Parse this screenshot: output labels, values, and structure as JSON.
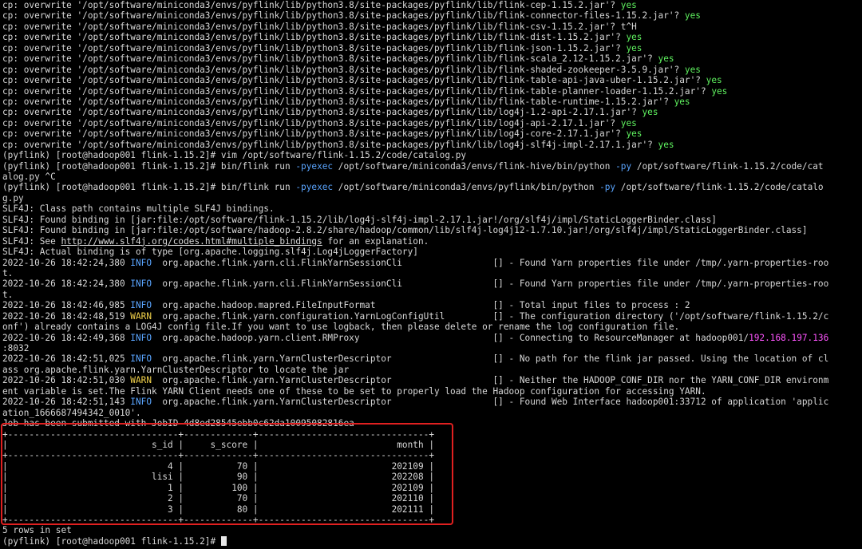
{
  "terminal": {
    "lines": [
      {
        "segments": [
          {
            "t": "cp: overwrite '/opt/software/miniconda3/envs/pyflink/lib/python3.8/site-packages/pyflink/lib/flink-cep-1.15.2.jar'? ",
            "s": ""
          },
          {
            "t": "yes",
            "s": "yes"
          }
        ]
      },
      {
        "segments": [
          {
            "t": "cp: overwrite '/opt/software/miniconda3/envs/pyflink/lib/python3.8/site-packages/pyflink/lib/flink-connector-files-1.15.2.jar'? ",
            "s": ""
          },
          {
            "t": "yes",
            "s": "yes"
          }
        ]
      },
      {
        "segments": [
          {
            "t": "cp: overwrite '/opt/software/miniconda3/envs/pyflink/lib/python3.8/site-packages/pyflink/lib/flink-csv-1.15.2.jar'? t^H",
            "s": ""
          }
        ]
      },
      {
        "segments": [
          {
            "t": "cp: overwrite '/opt/software/miniconda3/envs/pyflink/lib/python3.8/site-packages/pyflink/lib/flink-dist-1.15.2.jar'? ",
            "s": ""
          },
          {
            "t": "yes",
            "s": "yes"
          }
        ]
      },
      {
        "segments": [
          {
            "t": "cp: overwrite '/opt/software/miniconda3/envs/pyflink/lib/python3.8/site-packages/pyflink/lib/flink-json-1.15.2.jar'? ",
            "s": ""
          },
          {
            "t": "yes",
            "s": "yes"
          }
        ]
      },
      {
        "segments": [
          {
            "t": "cp: overwrite '/opt/software/miniconda3/envs/pyflink/lib/python3.8/site-packages/pyflink/lib/flink-scala_2.12-1.15.2.jar'? ",
            "s": ""
          },
          {
            "t": "yes",
            "s": "yes"
          }
        ]
      },
      {
        "segments": [
          {
            "t": "cp: overwrite '/opt/software/miniconda3/envs/pyflink/lib/python3.8/site-packages/pyflink/lib/flink-shaded-zookeeper-3.5.9.jar'? ",
            "s": ""
          },
          {
            "t": "yes",
            "s": "yes"
          }
        ]
      },
      {
        "segments": [
          {
            "t": "cp: overwrite '/opt/software/miniconda3/envs/pyflink/lib/python3.8/site-packages/pyflink/lib/flink-table-api-java-uber-1.15.2.jar'? ",
            "s": ""
          },
          {
            "t": "yes",
            "s": "yes"
          }
        ]
      },
      {
        "segments": [
          {
            "t": "cp: overwrite '/opt/software/miniconda3/envs/pyflink/lib/python3.8/site-packages/pyflink/lib/flink-table-planner-loader-1.15.2.jar'? ",
            "s": ""
          },
          {
            "t": "yes",
            "s": "yes"
          }
        ]
      },
      {
        "segments": [
          {
            "t": "cp: overwrite '/opt/software/miniconda3/envs/pyflink/lib/python3.8/site-packages/pyflink/lib/flink-table-runtime-1.15.2.jar'? ",
            "s": ""
          },
          {
            "t": "yes",
            "s": "yes"
          }
        ]
      },
      {
        "segments": [
          {
            "t": "cp: overwrite '/opt/software/miniconda3/envs/pyflink/lib/python3.8/site-packages/pyflink/lib/log4j-1.2-api-2.17.1.jar'? ",
            "s": ""
          },
          {
            "t": "yes",
            "s": "yes"
          }
        ]
      },
      {
        "segments": [
          {
            "t": "cp: overwrite '/opt/software/miniconda3/envs/pyflink/lib/python3.8/site-packages/pyflink/lib/log4j-api-2.17.1.jar'? ",
            "s": ""
          },
          {
            "t": "yes",
            "s": "yes"
          }
        ]
      },
      {
        "segments": [
          {
            "t": "cp: overwrite '/opt/software/miniconda3/envs/pyflink/lib/python3.8/site-packages/pyflink/lib/log4j-core-2.17.1.jar'? ",
            "s": ""
          },
          {
            "t": "yes",
            "s": "yes"
          }
        ]
      },
      {
        "segments": [
          {
            "t": "cp: overwrite '/opt/software/miniconda3/envs/pyflink/lib/python3.8/site-packages/pyflink/lib/log4j-slf4j-impl-2.17.1.jar'? ",
            "s": ""
          },
          {
            "t": "yes",
            "s": "yes"
          }
        ]
      },
      {
        "segments": [
          {
            "t": "(pyflink) [root@hadoop001 flink-1.15.2]# vim /opt/software/flink-1.15.2/code/catalog.py",
            "s": ""
          }
        ]
      },
      {
        "segments": [
          {
            "t": "(pyflink) [root@hadoop001 flink-1.15.2]# bin/flink run ",
            "s": ""
          },
          {
            "t": "-pyexec",
            "s": "flag"
          },
          {
            "t": " /opt/software/miniconda3/envs/flink-hive/bin/python ",
            "s": ""
          },
          {
            "t": "-py",
            "s": "flag"
          },
          {
            "t": " /opt/software/flink-1.15.2/code/cat",
            "s": ""
          }
        ]
      },
      {
        "segments": [
          {
            "t": "alog.py ^C",
            "s": ""
          }
        ]
      },
      {
        "segments": [
          {
            "t": "(pyflink) [root@hadoop001 flink-1.15.2]# bin/flink run ",
            "s": ""
          },
          {
            "t": "-pyexec",
            "s": "flag"
          },
          {
            "t": " /opt/software/miniconda3/envs/pyflink/bin/python ",
            "s": ""
          },
          {
            "t": "-py",
            "s": "flag"
          },
          {
            "t": " /opt/software/flink-1.15.2/code/catalo",
            "s": ""
          }
        ]
      },
      {
        "segments": [
          {
            "t": "g.py",
            "s": ""
          }
        ]
      },
      {
        "segments": [
          {
            "t": "SLF4J: Class path contains multiple SLF4J bindings.",
            "s": ""
          }
        ]
      },
      {
        "segments": [
          {
            "t": "SLF4J: Found binding in [jar:file:/opt/software/flink-1.15.2/lib/log4j-slf4j-impl-2.17.1.jar!/org/slf4j/impl/StaticLoggerBinder.class]",
            "s": ""
          }
        ]
      },
      {
        "segments": [
          {
            "t": "SLF4J: Found binding in [jar:file:/opt/software/hadoop-2.8.2/share/hadoop/common/lib/slf4j-log4j12-1.7.10.jar!/org/slf4j/impl/StaticLoggerBinder.class]",
            "s": ""
          }
        ]
      },
      {
        "segments": [
          {
            "t": "SLF4J: See ",
            "s": ""
          },
          {
            "t": "http://www.slf4j.org/codes.html#multiple_bindings",
            "s": "link"
          },
          {
            "t": " for an explanation.",
            "s": ""
          }
        ]
      },
      {
        "segments": [
          {
            "t": "SLF4J: Actual binding is of type [org.apache.logging.slf4j.Log4jLoggerFactory]",
            "s": ""
          }
        ]
      },
      {
        "segments": [
          {
            "t": "2022-10-26 18:42:24,380 ",
            "s": ""
          },
          {
            "t": "INFO",
            "s": "info"
          },
          {
            "t": "  org.apache.flink.yarn.cli.FlinkYarnSessionCli                 [] - Found Yarn properties file under /tmp/.yarn-properties-roo",
            "s": ""
          }
        ]
      },
      {
        "segments": [
          {
            "t": "t.",
            "s": ""
          }
        ]
      },
      {
        "segments": [
          {
            "t": "2022-10-26 18:42:24,380 ",
            "s": ""
          },
          {
            "t": "INFO",
            "s": "info"
          },
          {
            "t": "  org.apache.flink.yarn.cli.FlinkYarnSessionCli                 [] - Found Yarn properties file under /tmp/.yarn-properties-roo",
            "s": ""
          }
        ]
      },
      {
        "segments": [
          {
            "t": "t.",
            "s": ""
          }
        ]
      },
      {
        "segments": [
          {
            "t": "2022-10-26 18:42:46,985 ",
            "s": ""
          },
          {
            "t": "INFO",
            "s": "info"
          },
          {
            "t": "  org.apache.hadoop.mapred.FileInputFormat                      [] - Total input files to process : 2",
            "s": ""
          }
        ]
      },
      {
        "segments": [
          {
            "t": "2022-10-26 18:42:48,519 ",
            "s": ""
          },
          {
            "t": "WARN",
            "s": "warn"
          },
          {
            "t": "  org.apache.flink.yarn.configuration.YarnLogConfigUtil         [] - The configuration directory ('/opt/software/flink-1.15.2/c",
            "s": ""
          }
        ]
      },
      {
        "segments": [
          {
            "t": "onf') already contains a LOG4J config file.If you want to use logback, then please delete or rename the log configuration file.",
            "s": ""
          }
        ]
      },
      {
        "segments": [
          {
            "t": "2022-10-26 18:42:49,368 ",
            "s": ""
          },
          {
            "t": "INFO",
            "s": "info"
          },
          {
            "t": "  org.apache.hadoop.yarn.client.RMProxy                         [] - Connecting to ResourceManager at hadoop001/",
            "s": ""
          },
          {
            "t": "192.168.197.136",
            "s": "ip"
          }
        ]
      },
      {
        "segments": [
          {
            "t": ":8032",
            "s": ""
          }
        ]
      },
      {
        "segments": [
          {
            "t": "2022-10-26 18:42:51,025 ",
            "s": ""
          },
          {
            "t": "INFO",
            "s": "info"
          },
          {
            "t": "  org.apache.flink.yarn.YarnClusterDescriptor                   [] - No path for the flink jar passed. Using the location of cl",
            "s": ""
          }
        ]
      },
      {
        "segments": [
          {
            "t": "ass org.apache.flink.yarn.YarnClusterDescriptor to locate the jar",
            "s": ""
          }
        ]
      },
      {
        "segments": [
          {
            "t": "2022-10-26 18:42:51,030 ",
            "s": ""
          },
          {
            "t": "WARN",
            "s": "warn"
          },
          {
            "t": "  org.apache.flink.yarn.YarnClusterDescriptor                   [] - Neither the HADOOP_CONF_DIR nor the YARN_CONF_DIR environm",
            "s": ""
          }
        ]
      },
      {
        "segments": [
          {
            "t": "ent variable is set.The Flink YARN Client needs one of these to be set to properly load the Hadoop configuration for accessing YARN.",
            "s": ""
          }
        ]
      },
      {
        "segments": [
          {
            "t": "2022-10-26 18:42:51,143 ",
            "s": ""
          },
          {
            "t": "INFO",
            "s": "info"
          },
          {
            "t": "  org.apache.flink.yarn.YarnClusterDescriptor                   [] - Found Web Interface hadoop001:33712 of application 'applic",
            "s": ""
          }
        ]
      },
      {
        "segments": [
          {
            "t": "ation_1666687494342_0010'.",
            "s": ""
          }
        ]
      },
      {
        "segments": [
          {
            "t": "Job has been submitted with JobID 4d8ed28545ebb0c62da10095082816ea",
            "s": ""
          }
        ]
      },
      {
        "segments": [
          {
            "t": "+--------------------------------+-------------+--------------------------------+",
            "s": ""
          }
        ]
      },
      {
        "segments": [
          {
            "t": "|                           s_id |     s_score |                          month |",
            "s": ""
          }
        ]
      },
      {
        "segments": [
          {
            "t": "+--------------------------------+-------------+--------------------------------+",
            "s": ""
          }
        ]
      },
      {
        "segments": [
          {
            "t": "|                              4 |          70 |                         202109 |",
            "s": ""
          }
        ]
      },
      {
        "segments": [
          {
            "t": "|                           lisi |          90 |                         202208 |",
            "s": ""
          }
        ]
      },
      {
        "segments": [
          {
            "t": "|                              1 |         100 |                         202109 |",
            "s": ""
          }
        ]
      },
      {
        "segments": [
          {
            "t": "|                              2 |          70 |                         202110 |",
            "s": ""
          }
        ]
      },
      {
        "segments": [
          {
            "t": "|                              3 |          80 |                         202111 |",
            "s": ""
          }
        ]
      },
      {
        "segments": [
          {
            "t": "+--------------------------------+-------------+--------------------------------+",
            "s": ""
          }
        ]
      },
      {
        "segments": [
          {
            "t": "5 rows in set",
            "s": ""
          }
        ]
      },
      {
        "segments": [
          {
            "t": "(pyflink) [root@hadoop001 flink-1.15.2]# ",
            "s": ""
          }
        ],
        "cursor": true
      }
    ]
  },
  "colors": {
    "background": "#000000",
    "text": "#d8d8d8",
    "yes": "#5ff25f",
    "info": "#5aa5ff",
    "warn": "#f2d24b",
    "flag": "#5aa5ff",
    "ip": "#ff55ff",
    "highlight_box": "#e02020"
  }
}
